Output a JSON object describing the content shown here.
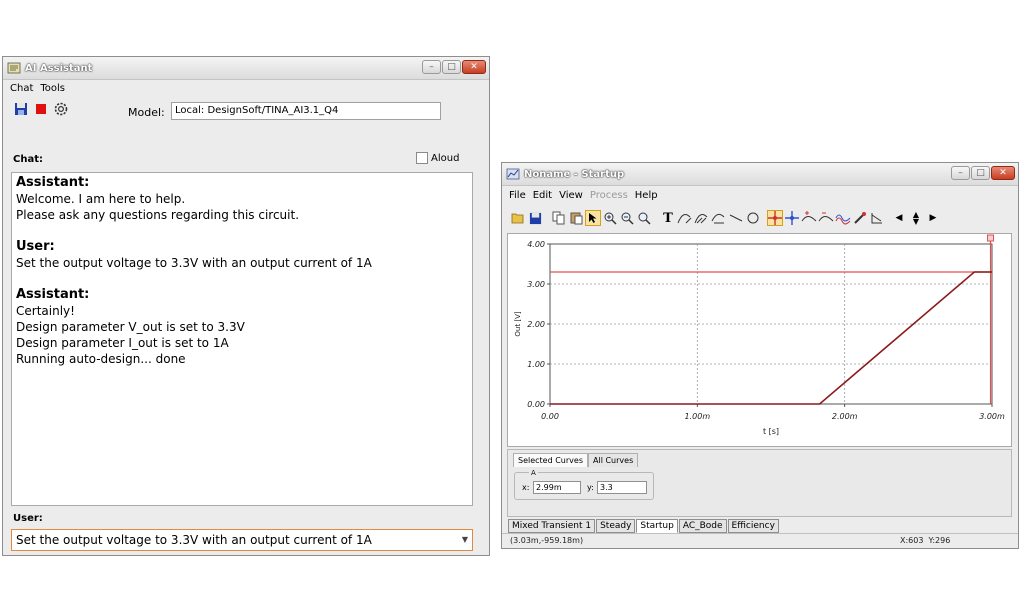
{
  "assistant_window": {
    "title": "AI Assistant",
    "menu": [
      "Chat",
      "Tools"
    ],
    "model_label": "Model:",
    "model_value": "Local: DesignSoft/TINA_AI3.1_Q4",
    "chat_label": "Chat:",
    "aloud_label": "Aloud",
    "messages": [
      {
        "role": "Assistant:",
        "lines": [
          "Welcome. I am here to help.",
          "Please ask any questions regarding this circuit."
        ]
      },
      {
        "role": "User:",
        "lines": [
          "Set the output voltage to 3.3V with an output current of 1A"
        ]
      },
      {
        "role": "Assistant:",
        "lines": [
          "Certainly!",
          "Design parameter V_out is set to 3.3V",
          "Design parameter I_out is set to 1A",
          "Running auto-design... done"
        ]
      }
    ],
    "user_label": "User:",
    "user_input": "Set the output voltage to 3.3V with an output current of 1A"
  },
  "graph_window": {
    "title": "Noname - Startup",
    "menu": [
      {
        "label": "File",
        "disabled": false
      },
      {
        "label": "Edit",
        "disabled": false
      },
      {
        "label": "View",
        "disabled": false
      },
      {
        "label": "Process",
        "disabled": true
      },
      {
        "label": "Help",
        "disabled": false
      }
    ],
    "inner_tabs": [
      "Selected Curves",
      "All Curves"
    ],
    "cursor_name": "A",
    "cursor_x_label": "x:",
    "cursor_x_value": "2.99m",
    "cursor_y_label": "y:",
    "cursor_y_value": "3.3",
    "bottom_tabs": [
      "Mixed Transient 1",
      "Steady",
      "Startup",
      "AC_Bode",
      "Efficiency"
    ],
    "active_tab": "Startup",
    "status_left": "(3.03m,-959.18m)",
    "status_right": "X:603  Y:296"
  },
  "chart_data": {
    "type": "line",
    "xlabel": "t [s]",
    "ylabel": "Out [V]",
    "x_ticks": [
      "0.00",
      "1.00m",
      "2.00m",
      "3.00m"
    ],
    "y_ticks": [
      "0.00",
      "1.00",
      "2.00",
      "3.00",
      "4.00"
    ],
    "xlim": [
      0,
      0.003
    ],
    "ylim": [
      0,
      4
    ],
    "grid": true,
    "series": [
      {
        "x": [
          0,
          0.00183,
          0.00288,
          0.003
        ],
        "y": [
          0,
          0,
          3.3,
          3.3
        ],
        "color": "#8b1a1a"
      }
    ],
    "cursor_line_y": 3.3,
    "cursor_line_x": 0.00299,
    "cursor_color": "#e05050"
  }
}
